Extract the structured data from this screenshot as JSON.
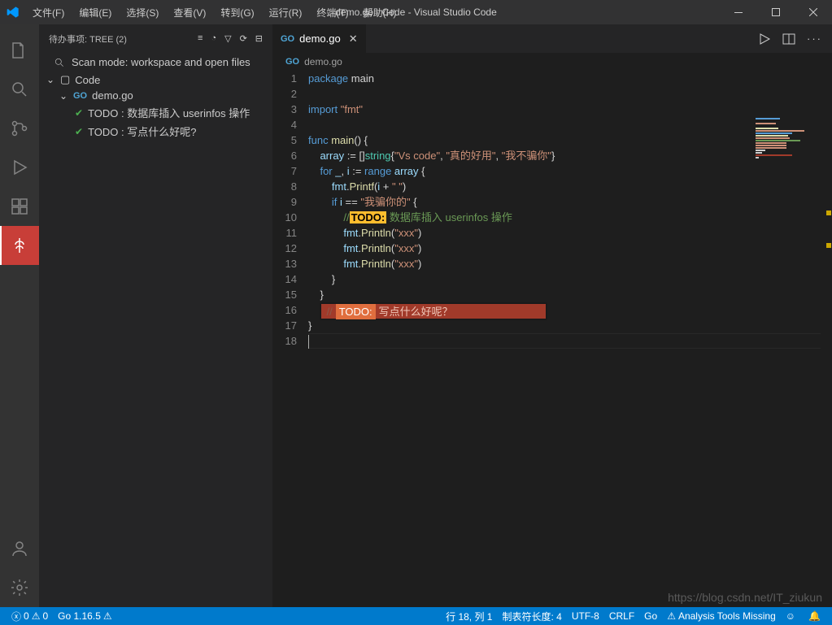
{
  "menubar": [
    "文件(F)",
    "编辑(E)",
    "选择(S)",
    "查看(V)",
    "转到(G)",
    "运行(R)",
    "终端(T)",
    "帮助(H)"
  ],
  "window_title": "demo.go - Code - Visual Studio Code",
  "sidebar": {
    "title": "待办事项: TREE (2)",
    "scan_mode": "Scan mode: workspace and open files",
    "root": "Code",
    "file": "demo.go",
    "todos": [
      "TODO : 数据库插入 userinfos 操作",
      "TODO : 写点什么好呢?"
    ]
  },
  "tab": {
    "label": "demo.go"
  },
  "breadcrumb": {
    "file": "demo.go"
  },
  "code": {
    "lines": [
      {
        "n": 1,
        "seg": [
          {
            "c": "kw",
            "t": "package"
          },
          {
            "c": "op",
            "t": " main"
          }
        ]
      },
      {
        "n": 2,
        "seg": []
      },
      {
        "n": 3,
        "seg": [
          {
            "c": "kw",
            "t": "import"
          },
          {
            "c": "op",
            "t": " "
          },
          {
            "c": "str",
            "t": "\"fmt\""
          }
        ]
      },
      {
        "n": 4,
        "seg": []
      },
      {
        "n": 5,
        "seg": [
          {
            "c": "kw",
            "t": "func"
          },
          {
            "c": "op",
            "t": " "
          },
          {
            "c": "fn",
            "t": "main"
          },
          {
            "c": "op",
            "t": "() {"
          }
        ]
      },
      {
        "n": 6,
        "seg": [
          {
            "c": "op",
            "t": "    "
          },
          {
            "c": "var",
            "t": "array"
          },
          {
            "c": "op",
            "t": " := []"
          },
          {
            "c": "ty",
            "t": "string"
          },
          {
            "c": "op",
            "t": "{"
          },
          {
            "c": "str",
            "t": "\"Vs code\""
          },
          {
            "c": "op",
            "t": ", "
          },
          {
            "c": "str",
            "t": "\"真的好用\""
          },
          {
            "c": "op",
            "t": ", "
          },
          {
            "c": "str",
            "t": "\"我不骗你\""
          },
          {
            "c": "op",
            "t": "}"
          }
        ]
      },
      {
        "n": 7,
        "seg": [
          {
            "c": "op",
            "t": "    "
          },
          {
            "c": "kw",
            "t": "for"
          },
          {
            "c": "op",
            "t": " "
          },
          {
            "c": "var",
            "t": "_"
          },
          {
            "c": "op",
            "t": ", "
          },
          {
            "c": "var",
            "t": "i"
          },
          {
            "c": "op",
            "t": " := "
          },
          {
            "c": "kw",
            "t": "range"
          },
          {
            "c": "op",
            "t": " "
          },
          {
            "c": "var",
            "t": "array"
          },
          {
            "c": "op",
            "t": " {"
          }
        ]
      },
      {
        "n": 8,
        "seg": [
          {
            "c": "op",
            "t": "        "
          },
          {
            "c": "var",
            "t": "fmt"
          },
          {
            "c": "op",
            "t": "."
          },
          {
            "c": "fn",
            "t": "Printf"
          },
          {
            "c": "op",
            "t": "("
          },
          {
            "c": "var",
            "t": "i"
          },
          {
            "c": "op",
            "t": " + "
          },
          {
            "c": "str",
            "t": "\" \""
          },
          {
            "c": "op",
            "t": ")"
          }
        ]
      },
      {
        "n": 9,
        "seg": [
          {
            "c": "op",
            "t": "        "
          },
          {
            "c": "kw",
            "t": "if"
          },
          {
            "c": "op",
            "t": " "
          },
          {
            "c": "var",
            "t": "i"
          },
          {
            "c": "op",
            "t": " == "
          },
          {
            "c": "str",
            "t": "\"我骗你的\""
          },
          {
            "c": "op",
            "t": " {"
          }
        ]
      },
      {
        "n": 10,
        "seg": [
          {
            "c": "op",
            "t": "            "
          },
          {
            "c": "cmt",
            "t": "//"
          },
          {
            "c": "todo-tag",
            "t": "TODO:"
          },
          {
            "c": "cmt",
            "t": " 数据库插入 userinfos 操作"
          }
        ]
      },
      {
        "n": 11,
        "seg": [
          {
            "c": "op",
            "t": "            "
          },
          {
            "c": "var",
            "t": "fmt"
          },
          {
            "c": "op",
            "t": "."
          },
          {
            "c": "fn",
            "t": "Println"
          },
          {
            "c": "op",
            "t": "("
          },
          {
            "c": "str",
            "t": "\"xxx\""
          },
          {
            "c": "op",
            "t": ")"
          }
        ]
      },
      {
        "n": 12,
        "seg": [
          {
            "c": "op",
            "t": "            "
          },
          {
            "c": "var",
            "t": "fmt"
          },
          {
            "c": "op",
            "t": "."
          },
          {
            "c": "fn",
            "t": "Println"
          },
          {
            "c": "op",
            "t": "("
          },
          {
            "c": "str",
            "t": "\"xxx\""
          },
          {
            "c": "op",
            "t": ")"
          }
        ]
      },
      {
        "n": 13,
        "seg": [
          {
            "c": "op",
            "t": "            "
          },
          {
            "c": "var",
            "t": "fmt"
          },
          {
            "c": "op",
            "t": "."
          },
          {
            "c": "fn",
            "t": "Println"
          },
          {
            "c": "op",
            "t": "("
          },
          {
            "c": "str",
            "t": "\"xxx\""
          },
          {
            "c": "op",
            "t": ")"
          }
        ]
      },
      {
        "n": 14,
        "seg": [
          {
            "c": "op",
            "t": "        }"
          }
        ]
      },
      {
        "n": 15,
        "seg": [
          {
            "c": "op",
            "t": "    }"
          }
        ]
      },
      {
        "n": 16,
        "seg": []
      },
      {
        "n": 17,
        "seg": [
          {
            "c": "op",
            "t": "}"
          }
        ]
      },
      {
        "n": 18,
        "seg": []
      }
    ],
    "highlight_todo": {
      "slash": "//",
      "tag": "TODO:",
      "text": "写点什么好呢？"
    }
  },
  "status": {
    "errors": "0",
    "warnings": "0",
    "go_version": "Go 1.16.5",
    "ln_col": "行 18, 列 1",
    "tab_size": "制表符长度: 4",
    "encoding": "UTF-8",
    "eol": "CRLF",
    "lang": "Go",
    "tools": "Analysis Tools Missing"
  },
  "watermark": "https://blog.csdn.net/IT_ziukun"
}
